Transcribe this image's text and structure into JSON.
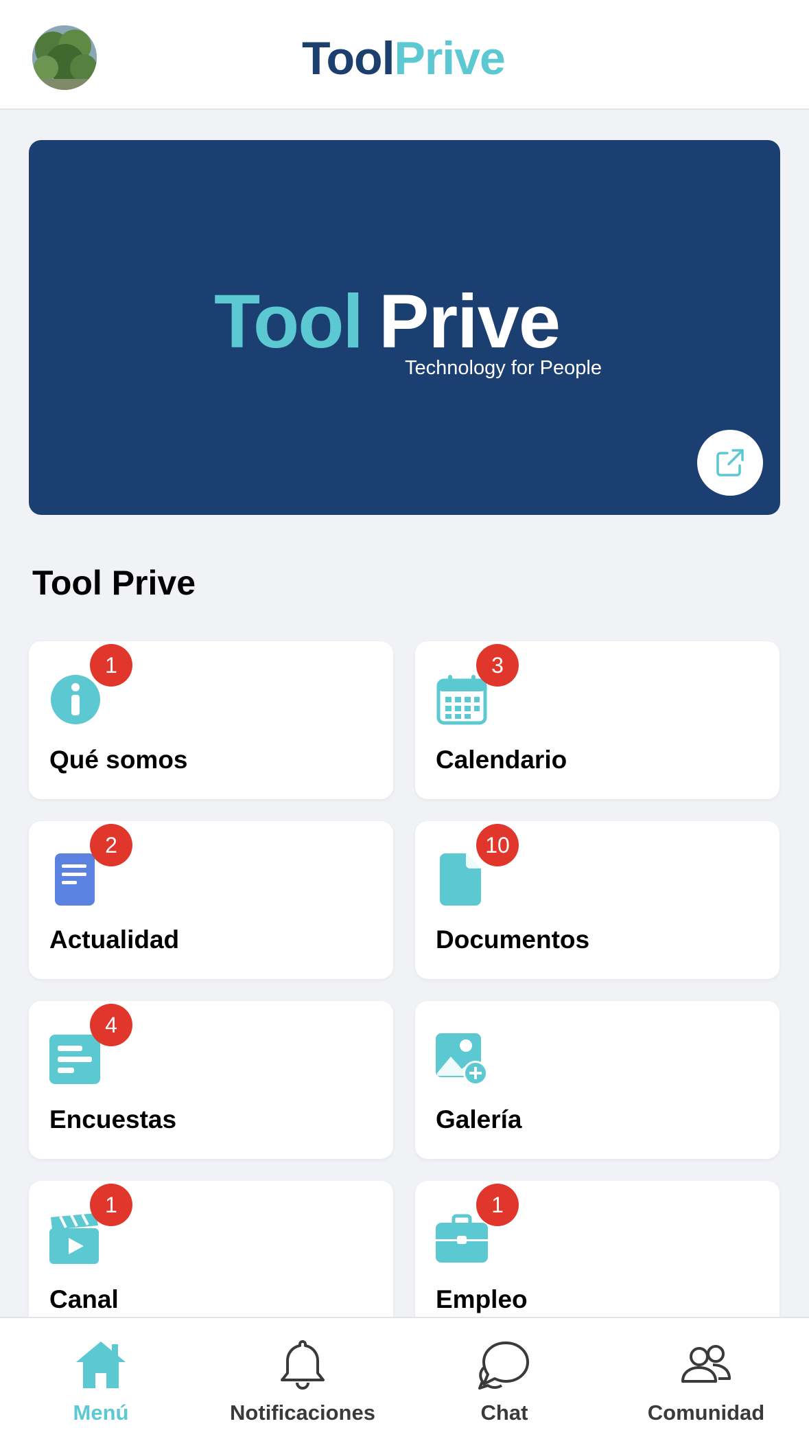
{
  "header": {
    "logo_part1": "Tool",
    "logo_part2": "Prive",
    "avatar_icon": "avatar-photo"
  },
  "banner": {
    "logo_part1": "Tool",
    "logo_part2": "Prive",
    "tagline": "Technology for People",
    "open_icon": "external-link-icon"
  },
  "section": {
    "title": "Tool Prive"
  },
  "tiles": [
    {
      "label": "Qué somos",
      "badge": "1",
      "icon": "info-icon"
    },
    {
      "label": "Calendario",
      "badge": "3",
      "icon": "calendar-icon"
    },
    {
      "label": "Actualidad",
      "badge": "2",
      "icon": "news-document-icon"
    },
    {
      "label": "Documentos",
      "badge": "10",
      "icon": "file-icon"
    },
    {
      "label": "Encuestas",
      "badge": "4",
      "icon": "survey-icon"
    },
    {
      "label": "Galería",
      "badge": "",
      "icon": "gallery-add-icon"
    },
    {
      "label": "Canal",
      "badge": "1",
      "icon": "video-channel-icon"
    },
    {
      "label": "Empleo",
      "badge": "1",
      "icon": "briefcase-icon"
    }
  ],
  "nav": [
    {
      "label": "Menú",
      "icon": "home-icon",
      "active": true
    },
    {
      "label": "Notificaciones",
      "icon": "bell-icon",
      "active": false
    },
    {
      "label": "Chat",
      "icon": "chat-icon",
      "active": false
    },
    {
      "label": "Comunidad",
      "icon": "community-icon",
      "active": false
    }
  ],
  "colors": {
    "brand_dark": "#1b3f70",
    "brand_accent": "#5bc8d2",
    "badge": "#e1362b",
    "doc_blue": "#5b82e0"
  }
}
